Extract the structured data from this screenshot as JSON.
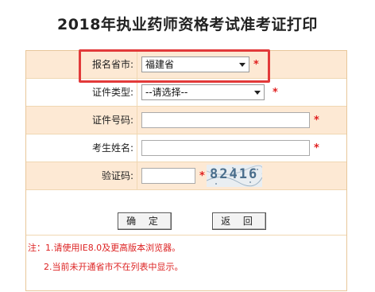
{
  "page": {
    "title": "2018年执业药师资格考试准考证打印"
  },
  "form": {
    "province_label": "报名省市:",
    "province_value": "福建省",
    "idtype_label": "证件类型:",
    "idtype_value": "--请选择--",
    "idnum_label": "证件号码:",
    "idnum_value": "",
    "name_label": "考生姓名:",
    "name_value": "",
    "captcha_label": "验证码:",
    "captcha_value": "",
    "captcha_image_text": "82416",
    "required_mark": "*"
  },
  "buttons": {
    "confirm": "确 定",
    "back": "返 回"
  },
  "notes": {
    "line1": "注：1.请使用IE8.0及更高版本浏览器。",
    "line2": "2.当前未开通省市不在列表中显示。"
  },
  "colors": {
    "accent_red": "#e23a3a",
    "row_shade": "#fde9d4",
    "border": "#e8c79a"
  }
}
